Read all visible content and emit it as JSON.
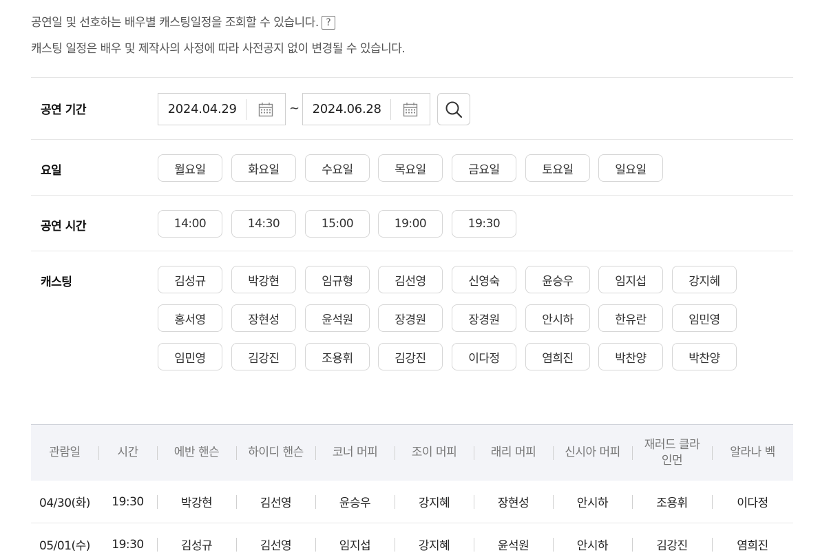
{
  "info": {
    "line1": "공연일 및 선호하는 배우별 캐스팅일정을 조회할 수 있습니다.",
    "help_glyph": "?",
    "line2": "캐스팅 일정은 배우 및 제작사의 사정에 따라 사전공지 없이 변경될 수 있습니다."
  },
  "period": {
    "label": "공연 기간",
    "start": "2024.04.29",
    "tilde": "~",
    "end": "2024.06.28"
  },
  "weekday": {
    "label": "요일",
    "options": [
      "월요일",
      "화요일",
      "수요일",
      "목요일",
      "금요일",
      "토요일",
      "일요일"
    ]
  },
  "time": {
    "label": "공연 시간",
    "options": [
      "14:00",
      "14:30",
      "15:00",
      "19:00",
      "19:30"
    ]
  },
  "casting": {
    "label": "캐스팅",
    "rows": [
      [
        "김성규",
        "박강현",
        "임규형",
        "김선영",
        "신영숙",
        "윤승우",
        "임지섭",
        "강지혜"
      ],
      [
        "홍서영",
        "장현성",
        "윤석원",
        "장경원",
        "장경원",
        "안시하",
        "한유란",
        "임민영"
      ],
      [
        "임민영",
        "김강진",
        "조용휘",
        "김강진",
        "이다정",
        "염희진",
        "박찬양",
        "박찬양"
      ]
    ]
  },
  "table": {
    "headers": [
      "관람일",
      "시간",
      "에반 핸슨",
      "하이디 핸슨",
      "코너 머피",
      "조이 머피",
      "래리 머피",
      "신시아 머피",
      "재러드 클라인먼",
      "알라나 벡"
    ],
    "rows": [
      [
        "04/30(화)",
        "19:30",
        "박강현",
        "김선영",
        "윤승우",
        "강지혜",
        "장현성",
        "안시하",
        "조용휘",
        "이다정"
      ],
      [
        "05/01(수)",
        "19:30",
        "김성규",
        "김선영",
        "임지섭",
        "강지혜",
        "윤석원",
        "안시하",
        "김강진",
        "염희진"
      ]
    ]
  }
}
